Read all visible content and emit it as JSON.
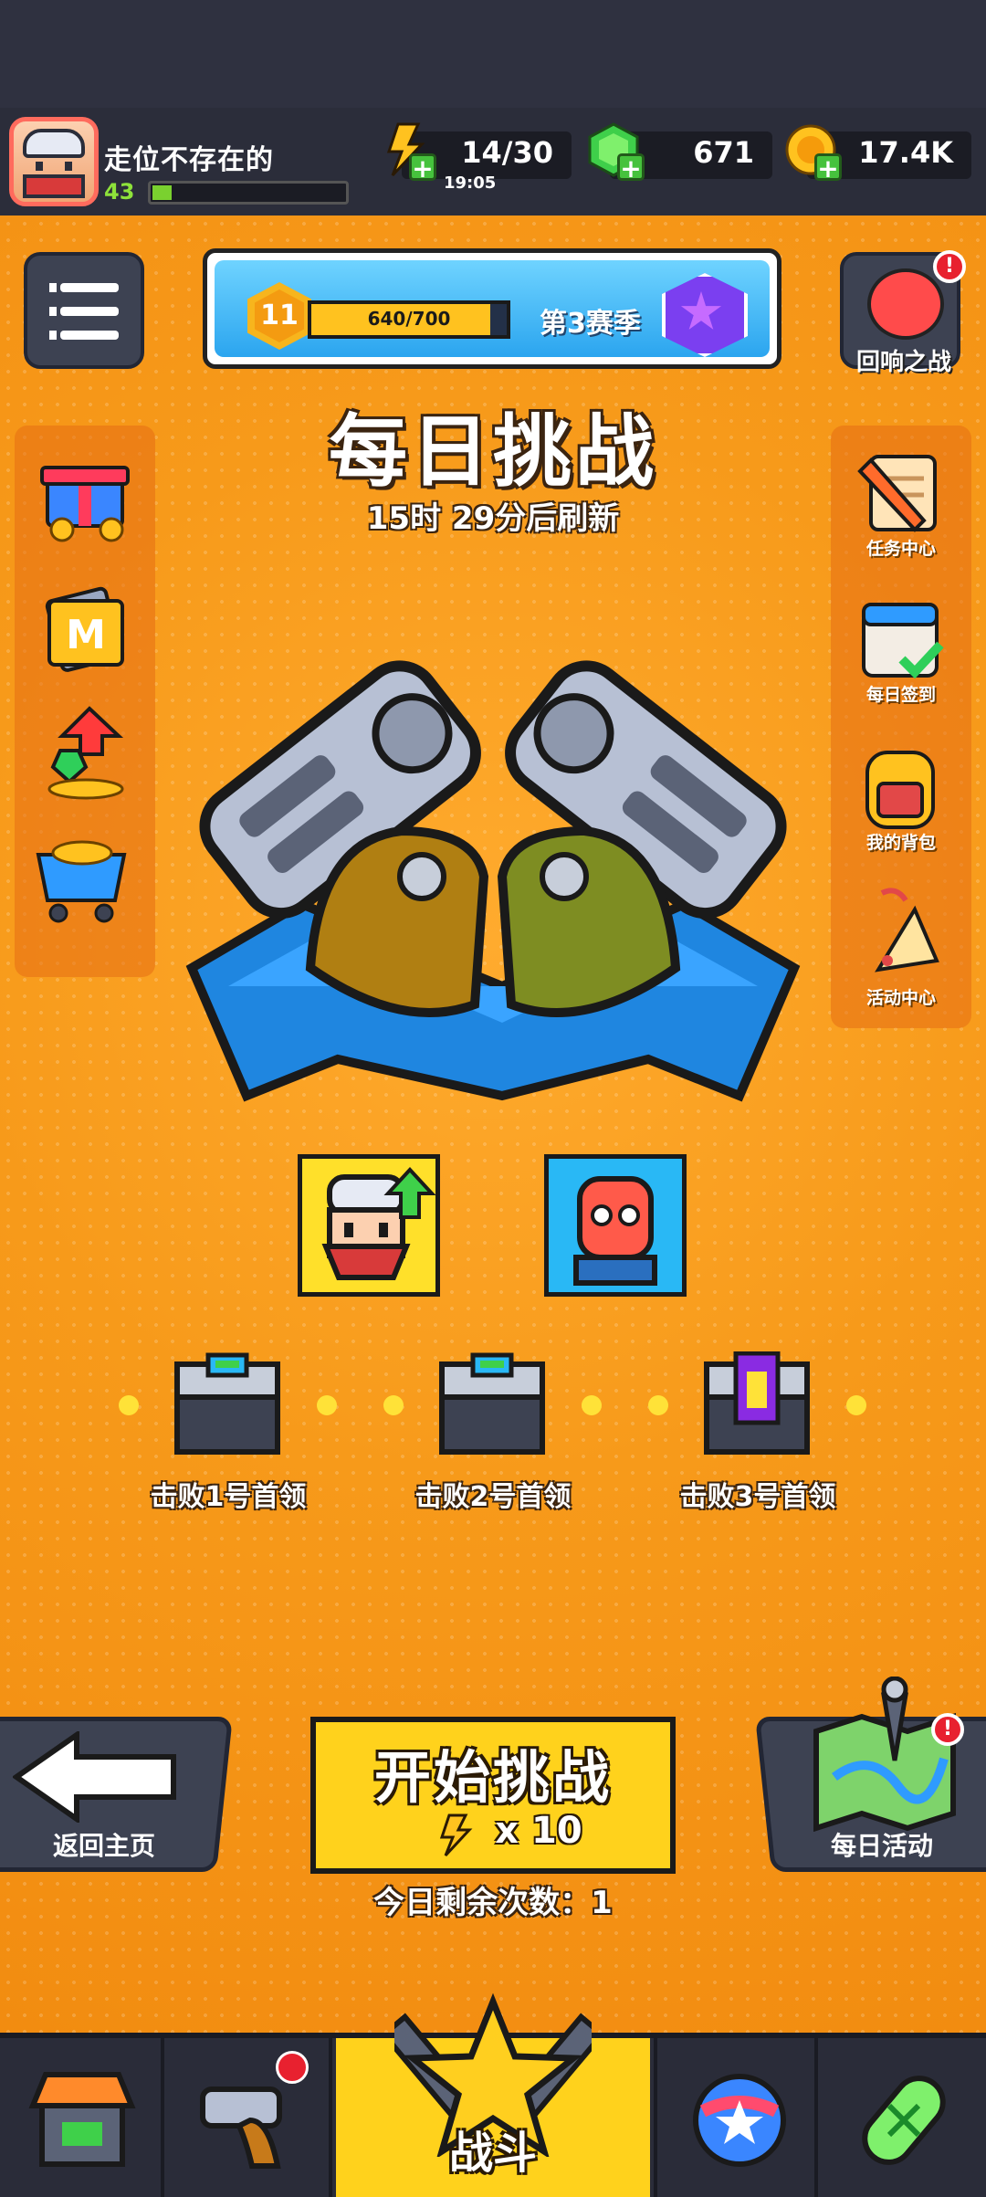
{
  "player": {
    "name": "走位不存在的",
    "level": "43",
    "xp_fraction": 0.1
  },
  "resources": {
    "energy": {
      "value": "14/30",
      "timer": "19:05"
    },
    "gems": {
      "value": "671"
    },
    "coins": {
      "value": "17.4K"
    }
  },
  "season": {
    "level": "11",
    "progress_text": "640/700",
    "progress_fraction": 0.914,
    "label": "第3赛季"
  },
  "echo_battle": {
    "label": "回响之战",
    "alert": "!"
  },
  "challenge": {
    "title": "每日挑战",
    "refresh_text": "15时 29分后刷新"
  },
  "right_menu": [
    {
      "label": "任务中心",
      "icon": "scroll-quill-icon"
    },
    {
      "label": "每日签到",
      "icon": "calendar-check-icon"
    },
    {
      "label": "我的背包",
      "icon": "backpack-icon"
    },
    {
      "label": "活动中心",
      "icon": "party-popper-icon"
    }
  ],
  "left_menu": [
    {
      "icon": "gift-icon"
    },
    {
      "icon": "monthly-card-icon"
    },
    {
      "icon": "gem-upgrade-icon"
    },
    {
      "icon": "shop-cart-icon"
    }
  ],
  "bosses": [
    {
      "label": "击败1号首领",
      "chest": "metal-chest-icon"
    },
    {
      "label": "击败2号首领",
      "chest": "metal-chest-icon"
    },
    {
      "label": "击败3号首领",
      "chest": "purple-chest-icon"
    }
  ],
  "actions": {
    "back_label": "返回主页",
    "start_label": "开始挑战",
    "start_cost": "x 10",
    "remaining": "今日剩余次数：1",
    "daily_label": "每日活动",
    "daily_alert": "!"
  },
  "bottom_nav": {
    "items": [
      {
        "icon": "shop-stall-icon"
      },
      {
        "icon": "revolver-icon",
        "alert": true
      },
      {
        "icon": "star-battle-icon",
        "label": "战斗"
      },
      {
        "icon": "star-ball-icon"
      },
      {
        "icon": "dna-capsule-icon"
      }
    ]
  },
  "colors": {
    "background": "#f39a1e",
    "accent_yellow": "#ffd21c",
    "dark_panel": "#3d4252",
    "alert_red": "#e8212f"
  }
}
